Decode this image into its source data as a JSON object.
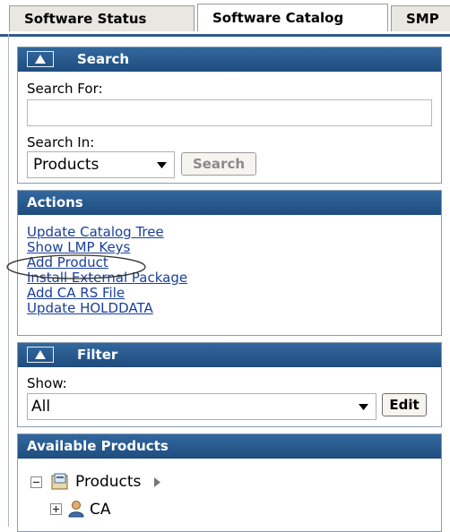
{
  "tabs": [
    {
      "label": "Software Status",
      "active": false
    },
    {
      "label": "Software Catalog",
      "active": true
    },
    {
      "label": "SMP",
      "active": false
    }
  ],
  "search": {
    "title": "Search",
    "search_for_label": "Search For:",
    "search_for_value": "",
    "search_in_label": "Search In:",
    "search_in_selected": "Products",
    "search_button": "Search"
  },
  "actions": {
    "title": "Actions",
    "links": [
      "Update Catalog Tree",
      "Show LMP Keys",
      "Add Product",
      "Install External Package",
      "Add CA RS File",
      "Update HOLDDATA"
    ],
    "highlighted_link": "Add Product"
  },
  "filter": {
    "title": "Filter",
    "show_label": "Show:",
    "show_selected": "All",
    "edit_button": "Edit"
  },
  "available_products": {
    "title": "Available Products",
    "tree": [
      {
        "label": "Products",
        "expanded": true,
        "icon": "folder-catalog-icon",
        "children": [
          {
            "label": "CA",
            "expanded": false,
            "icon": "person-icon"
          }
        ]
      }
    ]
  },
  "colors": {
    "panel_header": "#2a5d92",
    "link": "#1a3f9a",
    "tab_bg": "#e9e7e1"
  }
}
